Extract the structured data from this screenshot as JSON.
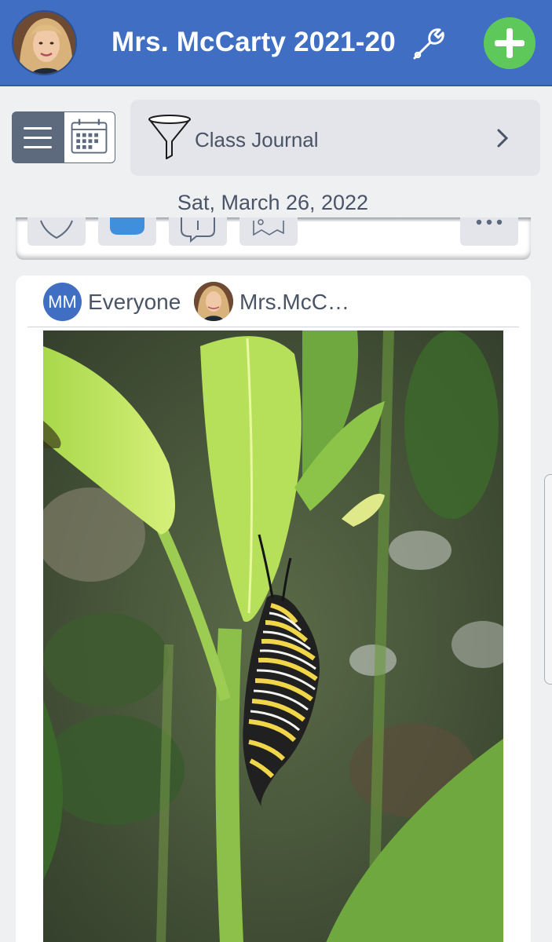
{
  "header": {
    "title": "Mrs. McCarty 2021-20",
    "avatar_icon": "teacher-avatar",
    "settings_icon": "wrench-icon",
    "add_icon": "plus-icon"
  },
  "toolbar": {
    "menu_icon": "hamburger-menu-icon",
    "calendar_icon": "calendar-icon",
    "filter_icon": "funnel-icon",
    "filter_label": "Class Journal",
    "chevron_icon": "chevron-right-icon"
  },
  "feed": {
    "date": "Sat, March 26, 2022"
  },
  "prev_post_actions": [
    "heart-icon",
    "comment-bubble-icon",
    "reply-bubble-icon",
    "map-icon",
    "more-dots-icon"
  ],
  "post": {
    "audience_initials": "MM",
    "audience": "Everyone",
    "author": "Mrs.McC…",
    "photo": "monarch-caterpillar-on-milkweed"
  },
  "colors": {
    "header_blue": "#3f6ec3",
    "add_green": "#5fc85a",
    "text_gray": "#4a5466",
    "background": "#eef0f2"
  }
}
